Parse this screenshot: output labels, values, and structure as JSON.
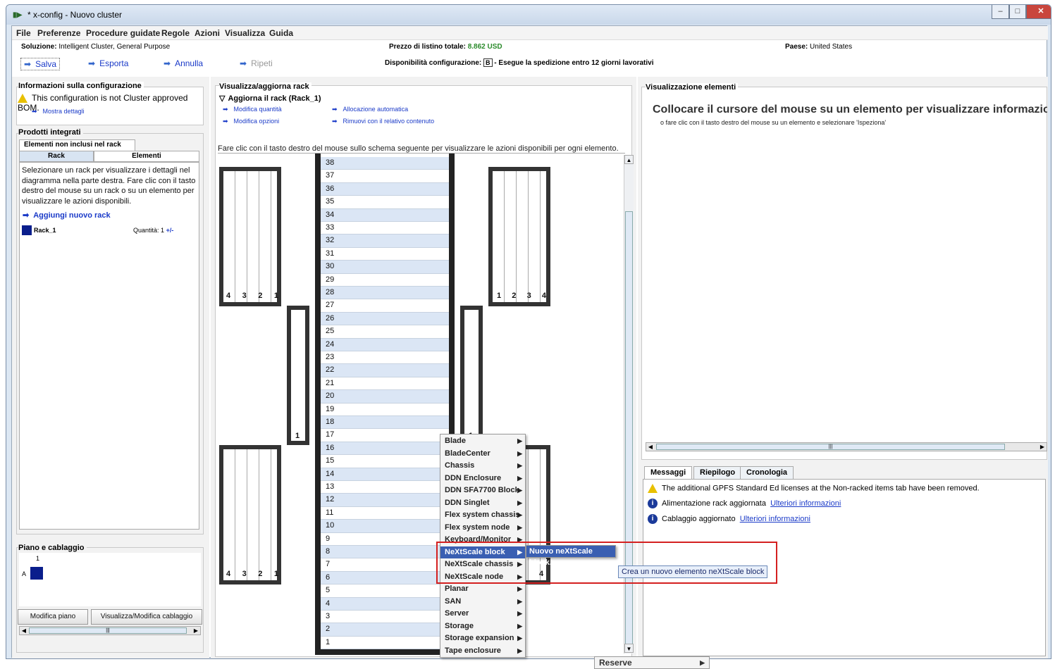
{
  "window": {
    "title": "* x-config - Nuovo cluster"
  },
  "menubar": [
    "File",
    "Preferenze",
    "Procedure guidate",
    "Regole",
    "Azioni",
    "Visualizza",
    "Guida"
  ],
  "info": {
    "solution_label": "Soluzione:",
    "solution_value": "Intelligent Cluster, General Purpose",
    "price_label": "Prezzo di listino totale:",
    "price_value": "8.862 USD",
    "country_label": "Paese:",
    "country_value": "United States",
    "availability_label": "Disponibilità configurazione:",
    "availability_badge": "B",
    "availability_text": "- Esegue la spedizione entro 12 giorni lavorativi"
  },
  "toolbar": {
    "save": "Salva",
    "export": "Esporta",
    "undo": "Annulla",
    "redo": "Ripeti"
  },
  "config_info": {
    "title": "Informazioni sulla configurazione",
    "warning": "This configuration is not Cluster approved BOM.",
    "details_link": "Mostra dettagli"
  },
  "integrated": {
    "title": "Prodotti integrati",
    "top_tab": "Elementi non inclusi nel rack",
    "tab_rack": "Rack",
    "tab_elements": "Elementi",
    "description": "Selezionare un rack per visualizzare i dettagli nel diagramma nella parte destra. Fare clic con il tasto destro del mouse su un rack o su un elemento per visualizzare le azioni disponibili.",
    "add_rack": "Aggiungi nuovo rack",
    "rack_name": "Rack_1",
    "qty_label": "Quantità:",
    "qty_value": "1",
    "qty_ctrl": "+/-"
  },
  "floor": {
    "title": "Piano e cablaggio",
    "col": "1",
    "row": "A",
    "edit_floor_btn": "Modifica piano",
    "cabling_btn": "Visualizza/Modifica cablaggio",
    "scroll_mark": "|||"
  },
  "rack_view": {
    "title": "Visualizza/aggiorna rack",
    "update_title": "Aggiorna il rack (Rack_1)",
    "actions": [
      "Modifica quantità",
      "Allocazione automatica",
      "Modifica opzioni",
      "Rimuovi con il relativo contenuto"
    ],
    "hint": "Fare clic con il tasto destro del mouse sullo schema seguente per visualizzare le azioni disponibili per ogni elemento.",
    "slots": [
      "38",
      "37",
      "36",
      "35",
      "34",
      "33",
      "32",
      "31",
      "30",
      "29",
      "28",
      "27",
      "26",
      "25",
      "24",
      "23",
      "22",
      "21",
      "20",
      "19",
      "18",
      "17",
      "16",
      "15",
      "14",
      "13",
      "12",
      "11",
      "10",
      "9",
      "8",
      "7",
      "6",
      "5",
      "4",
      "3",
      "2",
      "1"
    ],
    "pdu_left_top": [
      "4",
      "3",
      "2",
      "1"
    ],
    "pdu_right_top": [
      "1",
      "2",
      "3",
      "4"
    ],
    "pdu_left_bottom": [
      "4",
      "3",
      "2",
      "1"
    ],
    "pdu_right_bottom_visible": "4",
    "side_left": "1",
    "side_right": "1"
  },
  "context_menu": {
    "items": [
      "Blade",
      "BladeCenter",
      "Chassis",
      "DDN Enclosure",
      "DDN SFA7700 Block",
      "DDN Singlet",
      "Flex system chassis",
      "Flex system node",
      "Keyboard/Monitor",
      "NeXtScale block",
      "NeXtScale chassis",
      "NeXtScale node",
      "Planar",
      "SAN",
      "Server",
      "Storage",
      "Storage expansion",
      "Tape enclosure"
    ],
    "submenu_item": "Nuovo neXtScale block...",
    "tooltip": "Crea un nuovo elemento neXtScale block",
    "below_item": "Reserve"
  },
  "element_view": {
    "title": "Visualizzazione elementi",
    "heading": "Collocare il cursore del mouse su un elemento per visualizzare informazioni dettagliate",
    "subtext": "o fare clic con il tasto destro del mouse su un elemento e selezionare 'Ispeziona'",
    "scroll_mark": "|||"
  },
  "messages": {
    "tabs": [
      "Messaggi",
      "Riepilogo",
      "Cronologia"
    ],
    "rows": [
      {
        "icon": "warning-icon",
        "text": "The additional GPFS Standard Ed licenses at the Non-racked items tab have been removed.",
        "link": ""
      },
      {
        "icon": "info-icon",
        "text": "Alimentazione rack aggiornata",
        "link": "Ulteriori informazioni"
      },
      {
        "icon": "info-icon",
        "text": "Cablaggio aggiornato",
        "link": "Ulteriori informazioni"
      }
    ]
  },
  "colors": {
    "accent": "#1a3ac8",
    "highlight": "#3a5fb2",
    "callout": "#d42020",
    "rack_square": "#0a1e8c"
  }
}
